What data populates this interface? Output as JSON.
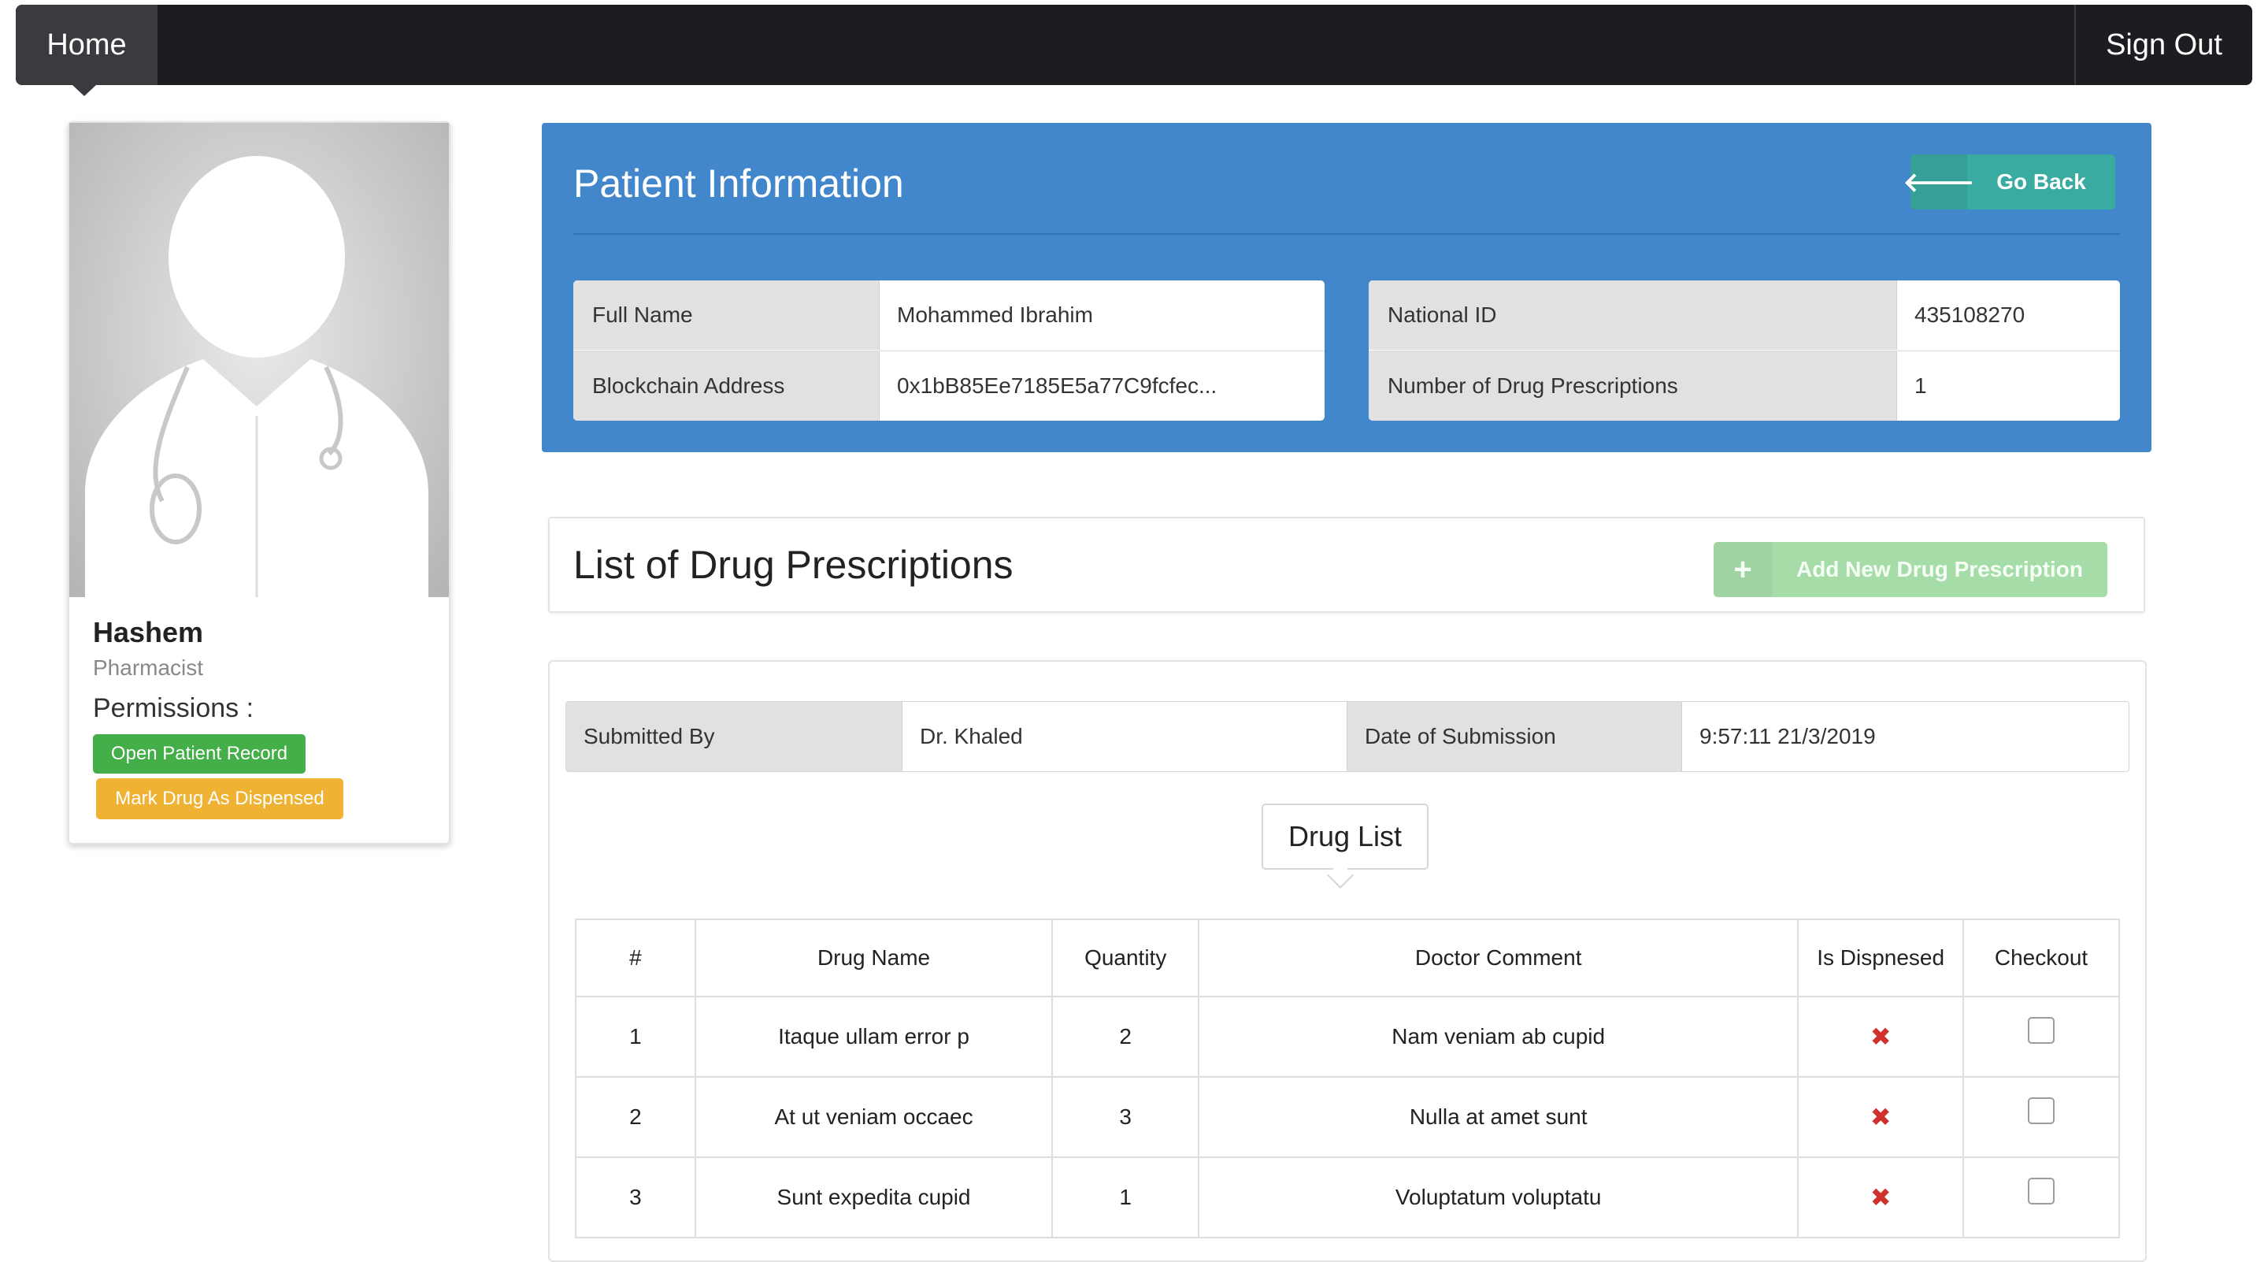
{
  "navbar": {
    "home_label": "Home",
    "signout_label": "Sign Out"
  },
  "profile": {
    "name": "Hashem",
    "role": "Pharmacist",
    "permissions_label": "Permissions :",
    "permissions": [
      "Open Patient Record",
      "Mark Drug As Dispensed"
    ]
  },
  "patient": {
    "title": "Patient Information",
    "go_back_label": "Go Back",
    "left_table": [
      {
        "key": "Full Name",
        "value": "Mohammed Ibrahim"
      },
      {
        "key": "Blockchain Address",
        "value": "0x1bB85Ee7185E5a77C9fcfec..."
      }
    ],
    "right_table": [
      {
        "key": "National ID",
        "value": "435108270"
      },
      {
        "key": "Number of Drug Prescriptions",
        "value": "1"
      }
    ]
  },
  "prescriptions": {
    "title": "List of Drug Prescriptions",
    "add_label": "Add New Drug Prescription",
    "submitted_by_label": "Submitted By",
    "submitted_by": "Dr. Khaled",
    "date_label": "Date of Submission",
    "date": "9:57:11 21/3/2019",
    "drug_list_label": "Drug List",
    "columns": [
      "#",
      "Drug Name",
      "Quantity",
      "Doctor Comment",
      "Is Dispnesed",
      "Checkout"
    ],
    "rows": [
      {
        "num": "1",
        "drug": "Itaque ullam error p",
        "qty": "2",
        "comment": "Nam veniam ab cupid",
        "dispensed": "✖"
      },
      {
        "num": "2",
        "drug": "At ut veniam occaec",
        "qty": "3",
        "comment": "Nulla at amet sunt",
        "dispensed": "✖"
      },
      {
        "num": "3",
        "drug": "Sunt expedita cupid",
        "qty": "1",
        "comment": "Voluptatum voluptatu",
        "dispensed": "✖"
      }
    ]
  },
  "colors": {
    "navbar": "#1c1d20",
    "panel_blue": "#4287cb",
    "go_back_teal": "#3aaba0",
    "add_button_green_disabled": "#a6dca8",
    "permission_green": "#44ae49",
    "permission_yellow": "#f0b233",
    "not_dispensed_red": "#d0312d"
  },
  "icons": {
    "go_back": "arrow-left-icon",
    "add": "plus-icon",
    "not_dispensed": "cross-icon",
    "avatar": "doctor-silhouette-icon"
  }
}
